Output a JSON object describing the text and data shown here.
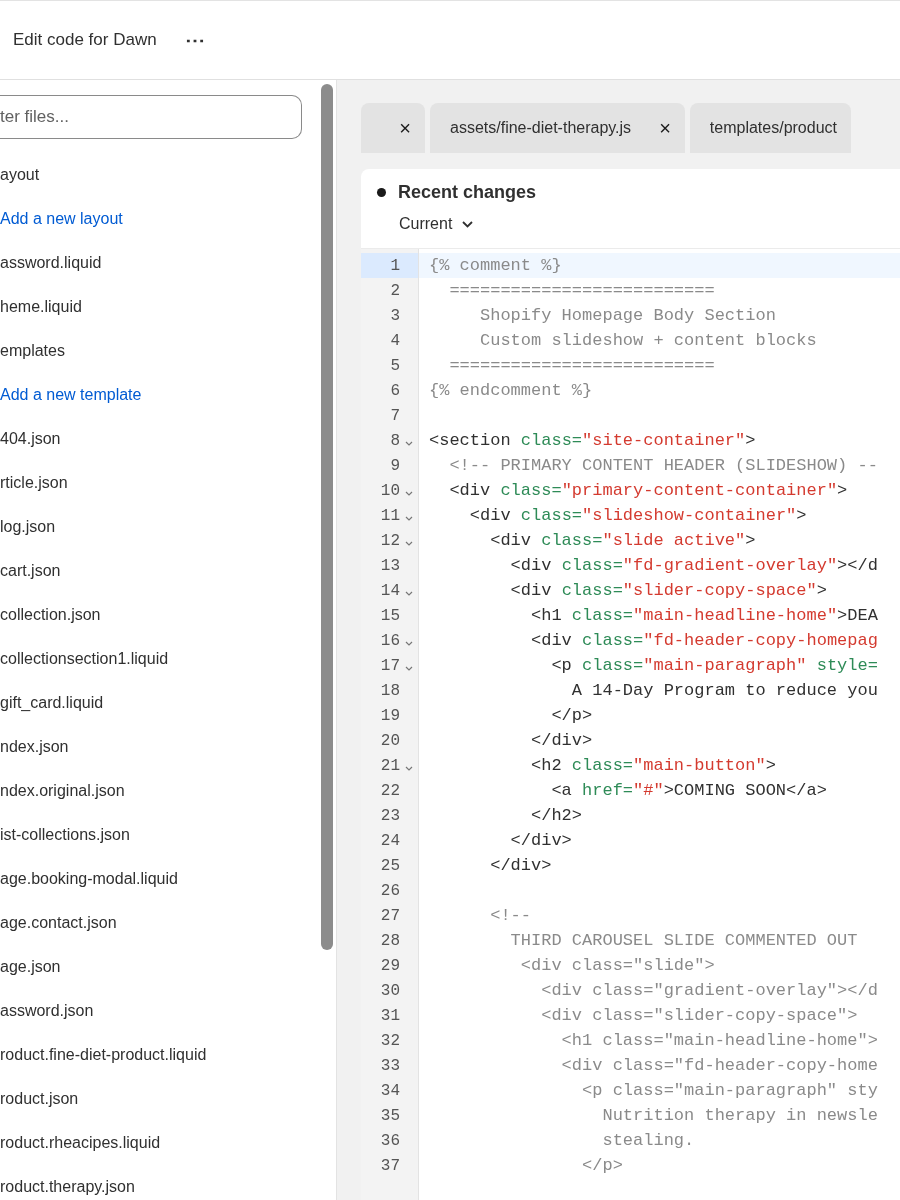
{
  "header": {
    "title": "Edit code for Dawn",
    "more_menu": "⋯"
  },
  "sidebar": {
    "filter": {
      "placeholder": "ter files..."
    },
    "items": [
      {
        "kind": "folder",
        "label": "ayout"
      },
      {
        "kind": "link",
        "label": "Add a new layout"
      },
      {
        "kind": "file",
        "label": "assword.liquid"
      },
      {
        "kind": "file",
        "label": "heme.liquid"
      },
      {
        "kind": "folder",
        "label": "emplates"
      },
      {
        "kind": "link",
        "label": "Add a new template"
      },
      {
        "kind": "file",
        "label": "404.json"
      },
      {
        "kind": "file",
        "label": "rticle.json"
      },
      {
        "kind": "file",
        "label": "log.json"
      },
      {
        "kind": "file",
        "label": "cart.json"
      },
      {
        "kind": "file",
        "label": "collection.json"
      },
      {
        "kind": "file",
        "label": "collectionsection1.liquid"
      },
      {
        "kind": "file",
        "label": "gift_card.liquid"
      },
      {
        "kind": "file",
        "label": "ndex.json"
      },
      {
        "kind": "file",
        "label": "ndex.original.json"
      },
      {
        "kind": "file",
        "label": "ist-collections.json"
      },
      {
        "kind": "file",
        "label": "age.booking-modal.liquid"
      },
      {
        "kind": "file",
        "label": "age.contact.json"
      },
      {
        "kind": "file",
        "label": "age.json"
      },
      {
        "kind": "file",
        "label": "assword.json"
      },
      {
        "kind": "file",
        "label": "roduct.fine-diet-product.liquid"
      },
      {
        "kind": "file",
        "label": "roduct.json"
      },
      {
        "kind": "file",
        "label": "roduct.rheacipes.liquid"
      },
      {
        "kind": "file",
        "label": "roduct.therapy.json"
      }
    ]
  },
  "tabs": [
    {
      "close": "×",
      "selected": false
    },
    {
      "label": "assets/fine-diet-therapy.js",
      "close": "×",
      "selected": false
    },
    {
      "label": "templates/product",
      "selected": false
    }
  ],
  "editor": {
    "title": "Recent changes",
    "version": "Current",
    "lines": [
      {
        "number": "1",
        "active": true,
        "fold": false,
        "segments": [
          {
            "kind": "comment",
            "text": "{% comment %}"
          }
        ]
      },
      {
        "number": "2",
        "active": false,
        "fold": false,
        "segments": [
          {
            "kind": "comment",
            "text": "  =========================="
          }
        ]
      },
      {
        "number": "3",
        "active": false,
        "fold": false,
        "segments": [
          {
            "kind": "comment",
            "text": "     Shopify Homepage Body Section"
          }
        ]
      },
      {
        "number": "4",
        "active": false,
        "fold": false,
        "segments": [
          {
            "kind": "comment",
            "text": "     Custom slideshow + content blocks"
          }
        ]
      },
      {
        "number": "5",
        "active": false,
        "fold": false,
        "segments": [
          {
            "kind": "comment",
            "text": "  =========================="
          }
        ]
      },
      {
        "number": "6",
        "active": false,
        "fold": false,
        "segments": [
          {
            "kind": "comment",
            "text": "{% endcomment %}"
          }
        ]
      },
      {
        "number": "7",
        "active": false,
        "fold": false
      },
      {
        "number": "8",
        "active": false,
        "fold": true,
        "segments": [
          {
            "kind": "tag",
            "text": "<section "
          },
          {
            "kind": "attr",
            "text": "class="
          },
          {
            "kind": "string",
            "text": "\"site-container\""
          },
          {
            "kind": "tag",
            "text": ">"
          }
        ]
      },
      {
        "number": "9",
        "active": false,
        "fold": false,
        "segments": [
          {
            "kind": "comment",
            "text": "  <!-- PRIMARY CONTENT HEADER (SLIDESHOW) --"
          }
        ]
      },
      {
        "number": "10",
        "active": false,
        "fold": true,
        "segments": [
          {
            "kind": "tag",
            "text": "  <div "
          },
          {
            "kind": "attr",
            "text": "class="
          },
          {
            "kind": "string",
            "text": "\"primary-content-container\""
          },
          {
            "kind": "tag",
            "text": ">"
          }
        ]
      },
      {
        "number": "11",
        "active": false,
        "fold": true,
        "segments": [
          {
            "kind": "tag",
            "text": "    <div "
          },
          {
            "kind": "attr",
            "text": "class="
          },
          {
            "kind": "string",
            "text": "\"slideshow-container\""
          },
          {
            "kind": "tag",
            "text": ">"
          }
        ]
      },
      {
        "number": "12",
        "active": false,
        "fold": true,
        "segments": [
          {
            "kind": "tag",
            "text": "      <div "
          },
          {
            "kind": "attr",
            "text": "class="
          },
          {
            "kind": "string",
            "text": "\"slide active\""
          },
          {
            "kind": "tag",
            "text": ">"
          }
        ]
      },
      {
        "number": "13",
        "active": false,
        "fold": false,
        "segments": [
          {
            "kind": "tag",
            "text": "        <div "
          },
          {
            "kind": "attr",
            "text": "class="
          },
          {
            "kind": "string",
            "text": "\"fd-gradient-overlay\""
          },
          {
            "kind": "tag",
            "text": "></d"
          }
        ]
      },
      {
        "number": "14",
        "active": false,
        "fold": true,
        "segments": [
          {
            "kind": "tag",
            "text": "        <div "
          },
          {
            "kind": "attr",
            "text": "class="
          },
          {
            "kind": "string",
            "text": "\"slider-copy-space\""
          },
          {
            "kind": "tag",
            "text": ">"
          }
        ]
      },
      {
        "number": "15",
        "active": false,
        "fold": false,
        "segments": [
          {
            "kind": "tag",
            "text": "          <h1 "
          },
          {
            "kind": "attr",
            "text": "class="
          },
          {
            "kind": "string",
            "text": "\"main-headline-home\""
          },
          {
            "kind": "tag",
            "text": ">DEA"
          }
        ]
      },
      {
        "number": "16",
        "active": false,
        "fold": true,
        "segments": [
          {
            "kind": "tag",
            "text": "          <div "
          },
          {
            "kind": "attr",
            "text": "class="
          },
          {
            "kind": "string",
            "text": "\"fd-header-copy-homepag"
          }
        ]
      },
      {
        "number": "17",
        "active": false,
        "fold": true,
        "segments": [
          {
            "kind": "tag",
            "text": "            <p "
          },
          {
            "kind": "attr",
            "text": "class="
          },
          {
            "kind": "string",
            "text": "\"main-paragraph\" "
          },
          {
            "kind": "attr",
            "text": "style="
          }
        ]
      },
      {
        "number": "18",
        "active": false,
        "fold": false,
        "segments": [
          {
            "kind": "tag",
            "text": "              A 14-Day Program to reduce you"
          }
        ]
      },
      {
        "number": "19",
        "active": false,
        "fold": false,
        "segments": [
          {
            "kind": "tag",
            "text": "            </p>"
          }
        ]
      },
      {
        "number": "20",
        "active": false,
        "fold": false,
        "segments": [
          {
            "kind": "tag",
            "text": "          </div>"
          }
        ]
      },
      {
        "number": "21",
        "active": false,
        "fold": true,
        "segments": [
          {
            "kind": "tag",
            "text": "          <h2 "
          },
          {
            "kind": "attr",
            "text": "class="
          },
          {
            "kind": "string",
            "text": "\"main-button\""
          },
          {
            "kind": "tag",
            "text": ">"
          }
        ]
      },
      {
        "number": "22",
        "active": false,
        "fold": false,
        "segments": [
          {
            "kind": "tag",
            "text": "            <a "
          },
          {
            "kind": "attr",
            "text": "href="
          },
          {
            "kind": "string",
            "text": "\"#\""
          },
          {
            "kind": "tag",
            "text": ">COMING SOON</a>"
          }
        ]
      },
      {
        "number": "23",
        "active": false,
        "fold": false,
        "segments": [
          {
            "kind": "tag",
            "text": "          </h2>"
          }
        ]
      },
      {
        "number": "24",
        "active": false,
        "fold": false,
        "segments": [
          {
            "kind": "tag",
            "text": "        </div>"
          }
        ]
      },
      {
        "number": "25",
        "active": false,
        "fold": false,
        "segments": [
          {
            "kind": "tag",
            "text": "      </div>"
          }
        ]
      },
      {
        "number": "26",
        "active": false,
        "fold": false
      },
      {
        "number": "27",
        "active": false,
        "fold": false,
        "segments": [
          {
            "kind": "comment",
            "text": "      <!--"
          }
        ]
      },
      {
        "number": "28",
        "active": false,
        "fold": false,
        "segments": [
          {
            "kind": "comment",
            "text": "        THIRD CAROUSEL SLIDE COMMENTED OUT"
          }
        ]
      },
      {
        "number": "29",
        "active": false,
        "fold": false,
        "segments": [
          {
            "kind": "comment",
            "text": "         <div class=\"slide\">"
          }
        ]
      },
      {
        "number": "30",
        "active": false,
        "fold": false,
        "segments": [
          {
            "kind": "comment",
            "text": "           <div class=\"gradient-overlay\"></d"
          }
        ]
      },
      {
        "number": "31",
        "active": false,
        "fold": false,
        "segments": [
          {
            "kind": "comment",
            "text": "           <div class=\"slider-copy-space\">"
          }
        ]
      },
      {
        "number": "32",
        "active": false,
        "fold": false,
        "segments": [
          {
            "kind": "comment",
            "text": "             <h1 class=\"main-headline-home\">"
          }
        ]
      },
      {
        "number": "33",
        "active": false,
        "fold": false,
        "segments": [
          {
            "kind": "comment",
            "text": "             <div class=\"fd-header-copy-home"
          }
        ]
      },
      {
        "number": "34",
        "active": false,
        "fold": false,
        "segments": [
          {
            "kind": "comment",
            "text": "               <p class=\"main-paragraph\" sty"
          }
        ]
      },
      {
        "number": "35",
        "active": false,
        "fold": false,
        "segments": [
          {
            "kind": "comment",
            "text": "                 Nutrition therapy in newsle"
          }
        ]
      },
      {
        "number": "36",
        "active": false,
        "fold": false,
        "segments": [
          {
            "kind": "comment",
            "text": "                 stealing."
          }
        ]
      },
      {
        "number": "37",
        "active": false,
        "fold": false,
        "segments": [
          {
            "kind": "comment",
            "text": "               </p>"
          }
        ]
      }
    ]
  }
}
